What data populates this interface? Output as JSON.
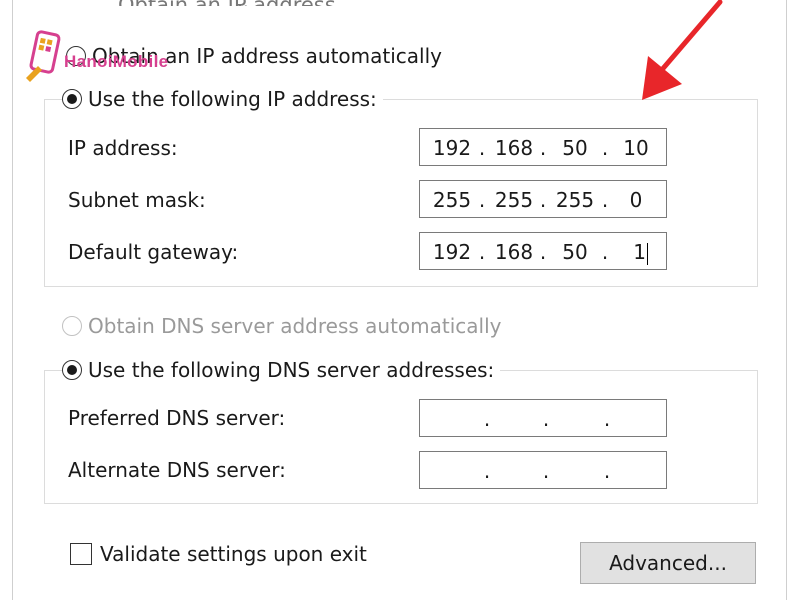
{
  "page": {
    "cut_off_heading": "Obtain an IP address automatically"
  },
  "ip_section": {
    "auto_option_label": "Obtain an IP address automatically",
    "manual_option_label": "Use the following IP address:",
    "selected": "manual",
    "fields": [
      {
        "label": "IP address:",
        "octets": [
          "192",
          "168",
          "50",
          "10"
        ]
      },
      {
        "label": "Subnet mask:",
        "octets": [
          "255",
          "255",
          "255",
          "0"
        ]
      },
      {
        "label": "Default gateway:",
        "octets": [
          "192",
          "168",
          "50",
          "1"
        ]
      }
    ]
  },
  "dns_section": {
    "auto_option_label": "Obtain DNS server address automatically",
    "auto_option_disabled": true,
    "manual_option_label": "Use the following DNS server addresses:",
    "selected": "manual",
    "fields": [
      {
        "label": "Preferred DNS server:",
        "octets": [
          "",
          "",
          "",
          ""
        ]
      },
      {
        "label": "Alternate DNS server:",
        "octets": [
          "",
          "",
          "",
          ""
        ]
      }
    ]
  },
  "footer": {
    "validate_label": "Validate settings upon exit",
    "validate_checked": false,
    "advanced_label": "Advanced..."
  },
  "watermark": {
    "text": "HanoiMobile",
    "icon": "phone-wrench-logo",
    "color": "#d6408f"
  },
  "annotation": {
    "icon": "red-arrow-icon",
    "color": "#e8262a"
  }
}
